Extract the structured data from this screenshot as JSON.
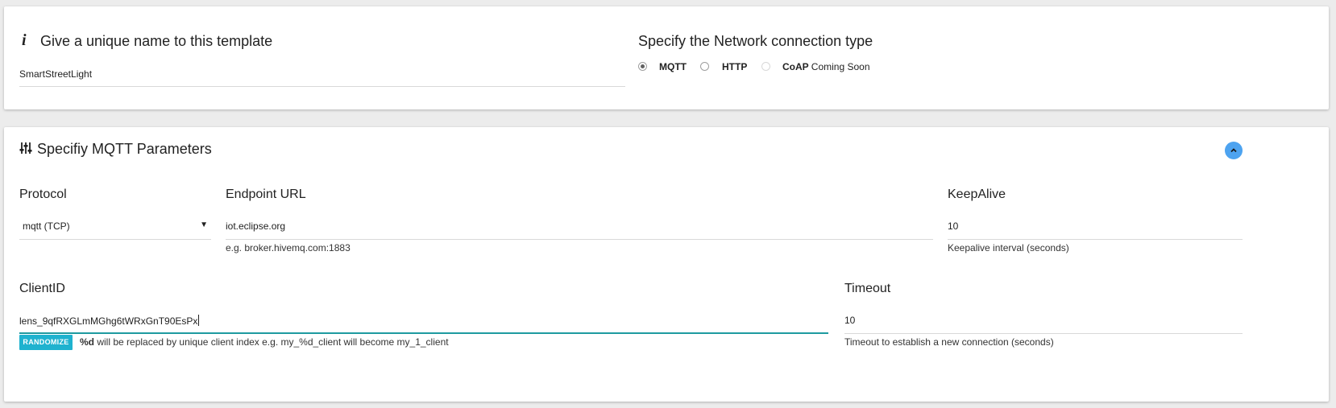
{
  "template": {
    "title": "Give a unique name to this template",
    "name_value": "SmartStreetLight"
  },
  "network": {
    "title": "Specify the Network connection type",
    "options": [
      {
        "label": "MQTT",
        "selected": true
      },
      {
        "label": "HTTP",
        "selected": false
      },
      {
        "label": "CoAP",
        "suffix": "Coming Soon",
        "disabled": true
      }
    ]
  },
  "mqtt": {
    "title": "Specifiy MQTT Parameters",
    "protocol": {
      "label": "Protocol",
      "value": "mqtt (TCP)"
    },
    "endpoint": {
      "label": "Endpoint URL",
      "value": "iot.eclipse.org",
      "helper": "e.g. broker.hivemq.com:1883"
    },
    "keepalive": {
      "label": "KeepAlive",
      "value": "10",
      "helper": "Keepalive interval (seconds)"
    },
    "clientid": {
      "label": "ClientID",
      "value": "lens_9qfRXGLmMGhg6tWRxGnT90EsPx",
      "randomize_label": "RANDOMIZE",
      "helper_bold": "%d",
      "helper": "will be replaced by unique client index e.g. my_%d_client will become my_1_client"
    },
    "timeout": {
      "label": "Timeout",
      "value": "10",
      "helper": "Timeout to establish a new connection (seconds)"
    }
  },
  "icons": {
    "info": "info-icon",
    "sliders": "sliders-icon",
    "collapse": "chevron-up-icon",
    "dropdown": "caret-down-icon"
  },
  "colors": {
    "accent_underline": "#1e9aa0",
    "randomize_button": "#1fb2cf",
    "collapse_button": "#4da3f0"
  }
}
